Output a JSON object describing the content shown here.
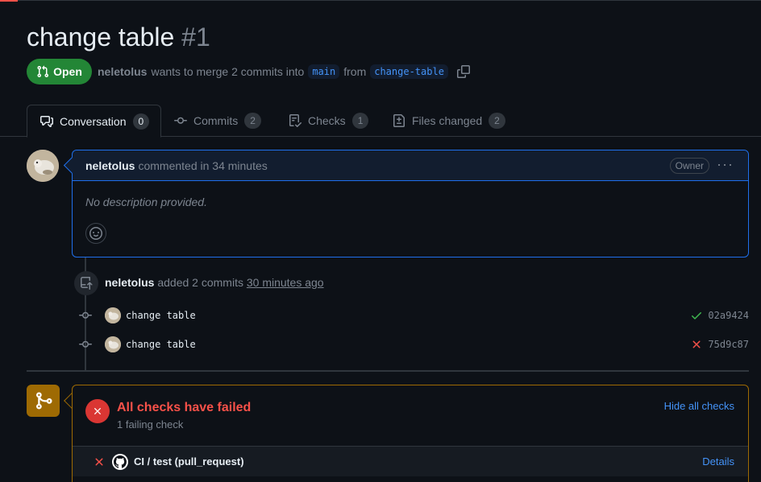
{
  "pr": {
    "title": "change table",
    "number": "#1",
    "state": "Open",
    "author": "neletolus",
    "merge_text": "wants to merge 2 commits into",
    "base_branch": "main",
    "from_text": "from",
    "head_branch": "change-table"
  },
  "tabs": [
    {
      "label": "Conversation",
      "count": "0"
    },
    {
      "label": "Commits",
      "count": "2"
    },
    {
      "label": "Checks",
      "count": "1"
    },
    {
      "label": "Files changed",
      "count": "2"
    }
  ],
  "comment": {
    "author": "neletolus",
    "action": "commented in 34 minutes",
    "badge": "Owner",
    "body": "No description provided."
  },
  "commit_event": {
    "author": "neletolus",
    "action": "added 2 commits",
    "time": "30 minutes ago"
  },
  "commits": [
    {
      "message": "change table",
      "sha": "02a9424",
      "status": "success"
    },
    {
      "message": "change table",
      "sha": "75d9c87",
      "status": "failure"
    }
  ],
  "checks": {
    "title": "All checks have failed",
    "subtitle": "1 failing check",
    "toggle_label": "Hide all checks",
    "items": [
      {
        "name": "CI / test (pull_request)",
        "link": "Details"
      }
    ]
  },
  "colors": {
    "open_green": "#238636",
    "fail_red": "#da3633",
    "link_blue": "#4493f8",
    "warn_orange": "#9e6a03"
  }
}
